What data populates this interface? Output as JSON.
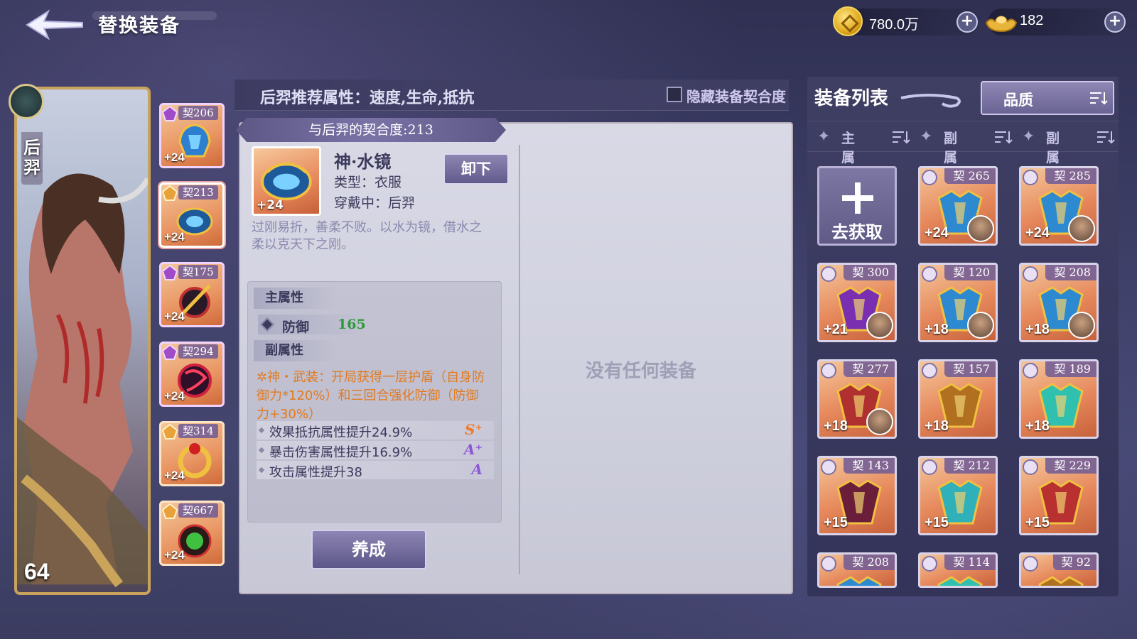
{
  "header": {
    "title": "替换装备",
    "gold": "780.0万",
    "ingot": "182"
  },
  "hero": {
    "name": "后羿",
    "level": "64"
  },
  "slots": [
    {
      "affinity": "契206",
      "level": "+24"
    },
    {
      "affinity": "契213",
      "level": "+24"
    },
    {
      "affinity": "契175",
      "level": "+24"
    },
    {
      "affinity": "契294",
      "level": "+24"
    },
    {
      "affinity": "契314",
      "level": "+24"
    },
    {
      "affinity": "契667",
      "level": "+24"
    }
  ],
  "recommend": {
    "text": "后羿推荐属性：速度,生命,抵抗",
    "hide_label": "隐藏装备契合度"
  },
  "detail": {
    "affinity": "与后羿的契合度:213",
    "name": "神·水镜",
    "type": "类型：衣服",
    "wearing": "穿戴中：后羿",
    "level": "+24",
    "unequip": "卸下",
    "desc": "过刚易折，善柔不败。以水为镜，借水之柔以克天下之刚。",
    "main_attr_header": "主属性",
    "main_attr_name": "防御",
    "main_attr_value": "165",
    "sub_attr_header": "副属性",
    "special": "神・武装：开局获得一层护盾（自身防御力*120%）和三回合强化防御（防御力+30%）",
    "sub_attrs": [
      {
        "text": "效果抵抗属性提升24.9%",
        "grade": "S⁺"
      },
      {
        "text": "暴击伤害属性提升16.9%",
        "grade": "A⁺"
      },
      {
        "text": "攻击属性提升38",
        "grade": "A"
      }
    ],
    "cultivate": "养成",
    "empty": "没有任何装备"
  },
  "list": {
    "title": "装备列表",
    "quality": "品质",
    "filters": [
      "主属",
      "副属",
      "副属"
    ],
    "obtain": "去获取",
    "items": [
      {
        "affinity": "契 265",
        "level": "+24"
      },
      {
        "affinity": "契 285",
        "level": "+24"
      },
      {
        "affinity": "契 300",
        "level": "+21"
      },
      {
        "affinity": "契 120",
        "level": "+18"
      },
      {
        "affinity": "契 208",
        "level": "+18"
      },
      {
        "affinity": "契 277",
        "level": "+18"
      },
      {
        "affinity": "契 157",
        "level": "+18"
      },
      {
        "affinity": "契 189",
        "level": "+18"
      },
      {
        "affinity": "契 143",
        "level": "+15"
      },
      {
        "affinity": "契 212",
        "level": "+15"
      },
      {
        "affinity": "契 229",
        "level": "+15"
      },
      {
        "affinity": "契 208",
        "level": ""
      },
      {
        "affinity": "契 114",
        "level": ""
      },
      {
        "affinity": "契 92",
        "level": ""
      }
    ]
  },
  "colors": {
    "accent_orange": "#e27a1f",
    "green_value": "#2f9a3a",
    "panel_bg": "#3f3e63",
    "item_bg": "#e6885b"
  }
}
